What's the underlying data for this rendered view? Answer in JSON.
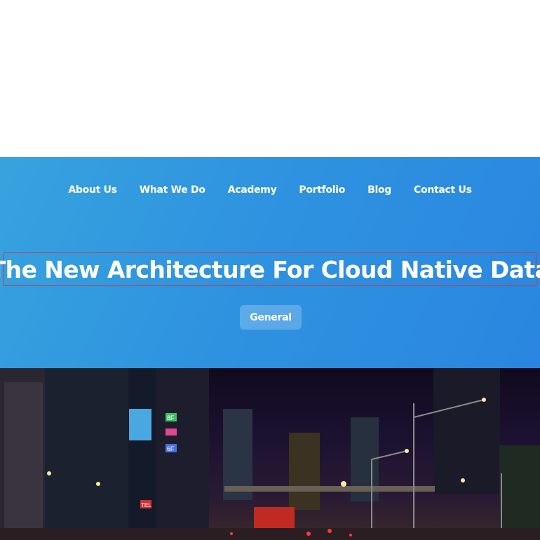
{
  "nav": {
    "items": [
      {
        "label": "About Us"
      },
      {
        "label": "What We Do"
      },
      {
        "label": "Academy"
      },
      {
        "label": "Portfolio"
      },
      {
        "label": "Blog"
      },
      {
        "label": "Contact Us"
      }
    ]
  },
  "hero": {
    "title": "The New Architecture For Cloud Native Data",
    "category_label": "General"
  },
  "photo": {
    "signs": [
      "8F",
      "6F",
      "TEL"
    ]
  }
}
